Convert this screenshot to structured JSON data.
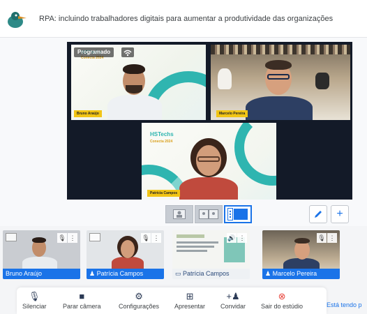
{
  "header": {
    "title": "RPA: incluindo trabalhadores digitais para aumentar a produtividade das organizações"
  },
  "stage": {
    "badge": "Programado",
    "event_logo": "HSTechs",
    "event_year": "Conecta 2024",
    "participants": [
      {
        "name": "Bruno Araújo"
      },
      {
        "name": "Marcelo Pereira"
      },
      {
        "name": "Patrícia Campos"
      }
    ]
  },
  "thumbnails": [
    {
      "name": "Bruno Araújo",
      "type": "camera"
    },
    {
      "name": "Patrícia Campos",
      "type": "camera"
    },
    {
      "name": "Patrícia Campos",
      "type": "screen"
    },
    {
      "name": "Marcelo Pereira",
      "type": "camera"
    }
  ],
  "toolbar": {
    "mute": "Silenciar",
    "stop_camera": "Parar câmera",
    "settings": "Configurações",
    "present": "Apresentar",
    "invite": "Convidar",
    "leave": "Sair do estúdio"
  },
  "side_link": "Está tendo p",
  "colors": {
    "accent": "#1a73e8",
    "nametag": "#f2c515",
    "teal": "#2fb5b0",
    "leave": "#e8453c"
  }
}
